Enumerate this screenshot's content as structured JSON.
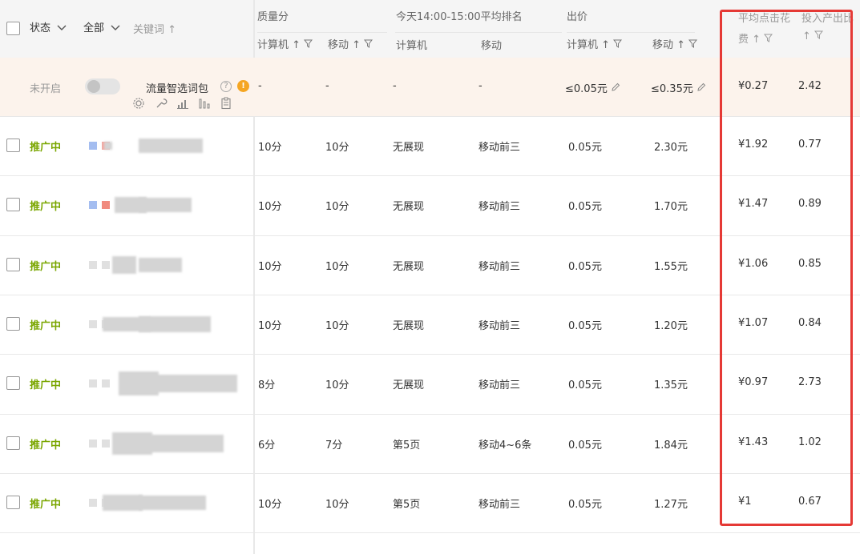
{
  "header": {
    "status_label": "状态",
    "all_label": "全部",
    "keyword_label": "关键词",
    "quality_group": "质量分",
    "rank_group": "今天14:00-15:00平均排名",
    "bid_group": "出价",
    "avg_click_cost_line1": "平均点击花",
    "avg_click_cost_line2": "费",
    "roi_line1": "投入产出比",
    "sub_pc": "计算机",
    "sub_mobile": "移动",
    "sort_arrow": "↑",
    "filter_icon": "filter-icon",
    "chevron_icon": "chevron-down-icon"
  },
  "special_row": {
    "status": "未开启",
    "name": "流量智选词包",
    "q_pc": "-",
    "q_mobile": "-",
    "rank_pc": "-",
    "rank_mobile": "-",
    "bid_pc": "≤0.05元",
    "bid_mobile": "≤0.35元",
    "avg_cost": "¥0.27",
    "roi": "2.42",
    "help_glyph": "?",
    "warn_glyph": "!"
  },
  "rows": [
    {
      "status": "推广中",
      "q_pc": "10分",
      "q_mobile": "10分",
      "rank_pc": "无展现",
      "rank_mobile": "移动前三",
      "bid_pc": "0.05元",
      "bid_mobile": "2.30元",
      "avg_cost": "¥1.92",
      "roi": "0.77"
    },
    {
      "status": "推广中",
      "q_pc": "10分",
      "q_mobile": "10分",
      "rank_pc": "无展现",
      "rank_mobile": "移动前三",
      "bid_pc": "0.05元",
      "bid_mobile": "1.70元",
      "avg_cost": "¥1.47",
      "roi": "0.89"
    },
    {
      "status": "推广中",
      "q_pc": "10分",
      "q_mobile": "10分",
      "rank_pc": "无展现",
      "rank_mobile": "移动前三",
      "bid_pc": "0.05元",
      "bid_mobile": "1.55元",
      "avg_cost": "¥1.06",
      "roi": "0.85"
    },
    {
      "status": "推广中",
      "q_pc": "10分",
      "q_mobile": "10分",
      "rank_pc": "无展现",
      "rank_mobile": "移动前三",
      "bid_pc": "0.05元",
      "bid_mobile": "1.20元",
      "avg_cost": "¥1.07",
      "roi": "0.84"
    },
    {
      "status": "推广中",
      "q_pc": "8分",
      "q_mobile": "10分",
      "rank_pc": "无展现",
      "rank_mobile": "移动前三",
      "bid_pc": "0.05元",
      "bid_mobile": "1.35元",
      "avg_cost": "¥0.97",
      "roi": "2.73"
    },
    {
      "status": "推广中",
      "q_pc": "6分",
      "q_mobile": "7分",
      "rank_pc": "第5页",
      "rank_mobile": "移动4~6条",
      "bid_pc": "0.05元",
      "bid_mobile": "1.84元",
      "avg_cost": "¥1.43",
      "roi": "1.02"
    },
    {
      "status": "推广中",
      "q_pc": "10分",
      "q_mobile": "10分",
      "rank_pc": "第5页",
      "rank_mobile": "移动前三",
      "bid_pc": "0.05元",
      "bid_mobile": "1.27元",
      "avg_cost": "¥1",
      "roi": "0.67"
    }
  ],
  "colors": {
    "status_on": "#7aa600",
    "highlight": "#e53935",
    "special_row_bg": "#fcf3ec"
  }
}
